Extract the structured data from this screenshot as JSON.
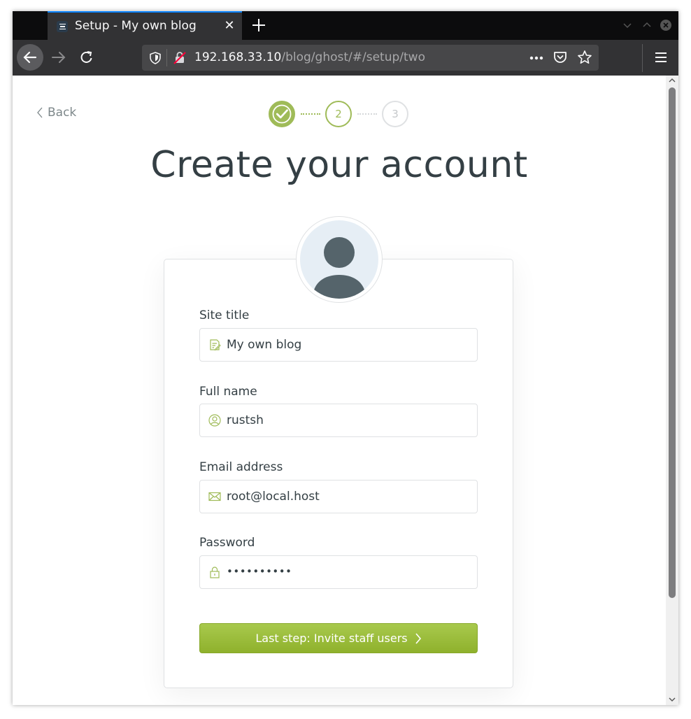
{
  "browser": {
    "tab_title": "Setup - My own blog",
    "url_host": "192.168.33.10",
    "url_path": "/blog/ghost/#/setup/two"
  },
  "page": {
    "back_label": "Back",
    "steps": [
      "2",
      "3"
    ],
    "title": "Create your account"
  },
  "form": {
    "site_title_label": "Site title",
    "site_title_value": "My own blog",
    "full_name_label": "Full name",
    "full_name_value": "rustsh",
    "email_label": "Email address",
    "email_value": "root@local.host",
    "password_label": "Password",
    "password_value": "••••••••••",
    "submit_label": "Last step: Invite staff users"
  },
  "colors": {
    "accent": "#9fbb58",
    "button": "#9fbb58",
    "text": "#343f44",
    "browser_chrome": "#323234"
  },
  "icons": {
    "site_title": "pencil-note-icon",
    "full_name": "user-circle-icon",
    "email": "envelope-icon",
    "password": "lock-icon"
  }
}
